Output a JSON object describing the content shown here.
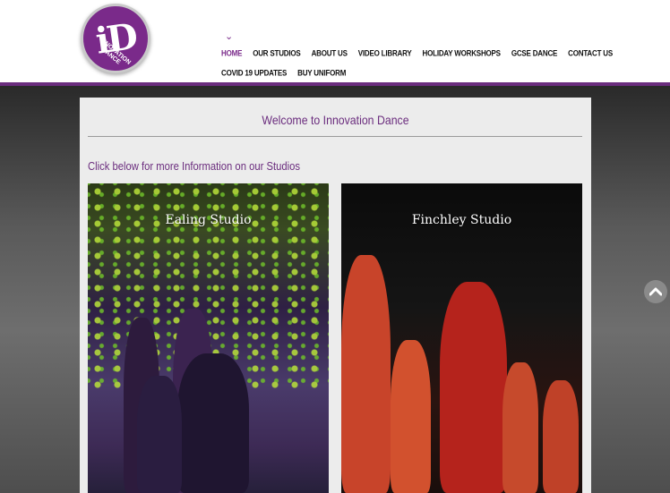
{
  "logo": {
    "mark": "iD",
    "text": "INNOVATION DANCE"
  },
  "nav": {
    "chevron": "⌄",
    "row1": [
      "HOME",
      "OUR STUDIOS",
      "ABOUT US",
      "VIDEO LIBRARY",
      "HOLIDAY WORKSHOPS",
      "GCSE DANCE",
      "CONTACT US"
    ],
    "row2": [
      "COVID 19 UPDATES",
      "BUY UNIFORM"
    ]
  },
  "main": {
    "welcome": "Welcome to Innovation Dance",
    "subheading": "Click below for more Information on our Studios",
    "studios": [
      {
        "title": "Ealing Studio"
      },
      {
        "title": "Finchley Studio"
      }
    ]
  },
  "scroll_top": {
    "icon": "chevron-up-icon"
  },
  "colors": {
    "brand": "#6b2d7e",
    "panel": "#ececec"
  }
}
